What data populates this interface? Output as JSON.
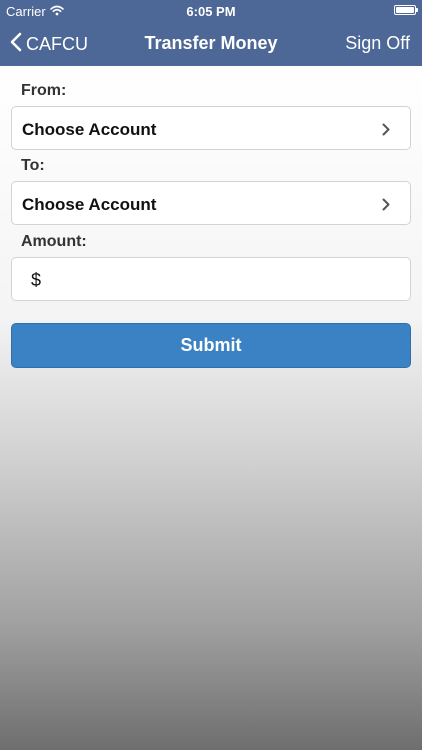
{
  "status_bar": {
    "carrier": "Carrier",
    "time": "6:05 PM",
    "wifi_icon": "wifi-icon",
    "battery_icon": "battery-icon"
  },
  "nav": {
    "back_label": "CAFCU",
    "title": "Transfer Money",
    "sign_off": "Sign Off"
  },
  "form": {
    "from_label": "From:",
    "from_value": "Choose Account",
    "to_label": "To:",
    "to_value": "Choose Account",
    "amount_label": "Amount:",
    "currency_symbol": "$",
    "amount_value": "",
    "submit_label": "Submit"
  },
  "colors": {
    "nav_background": "#4d6796",
    "submit_background": "#3b82c4"
  }
}
